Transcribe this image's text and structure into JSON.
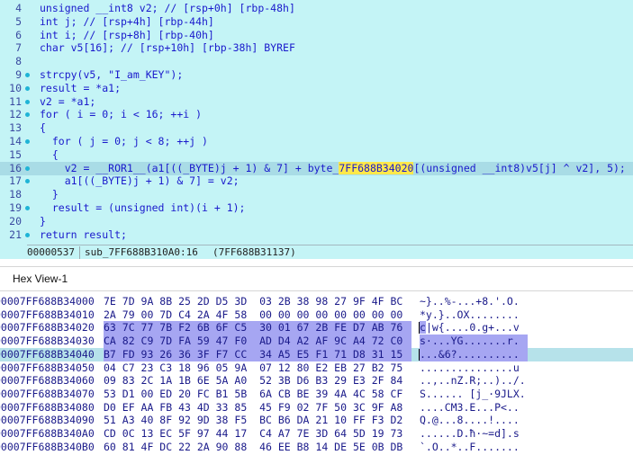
{
  "pseudocode": {
    "lines": [
      {
        "num": "4",
        "text": "unsigned __int8 v2; // [rsp+0h] [rbp-48h]"
      },
      {
        "num": "5",
        "text": "int j; // [rsp+4h] [rbp-44h]"
      },
      {
        "num": "6",
        "text": "int i; // [rsp+8h] [rbp-40h]"
      },
      {
        "num": "7",
        "text": "char v5[16]; // [rsp+10h] [rbp-38h] BYREF"
      },
      {
        "num": "8",
        "text": ""
      },
      {
        "num": "9",
        "text": "strcpy(v5, \"I_am_KEY\");"
      },
      {
        "num": "10",
        "text": "result = *a1;"
      },
      {
        "num": "11",
        "text": "v2 = *a1;"
      },
      {
        "num": "12",
        "text": "for ( i = 0; i < 16; ++i )"
      },
      {
        "num": "13",
        "text": "{"
      },
      {
        "num": "14",
        "text": "  for ( j = 0; j < 8; ++j )"
      },
      {
        "num": "15",
        "text": "  {"
      },
      {
        "num": "16",
        "text": "    v2 = __ROR1__(a1[((_BYTE)j + 1) & 7] + byte_7FF688B34020[(unsigned __int8)v5[j] ^ v2], 5);"
      },
      {
        "num": "17",
        "text": "    a1[((_BYTE)j + 1) & 7] = v2;"
      },
      {
        "num": "18",
        "text": "  }"
      },
      {
        "num": "19",
        "text": "  result = (unsigned int)(i + 1);"
      },
      {
        "num": "20",
        "text": "}"
      },
      {
        "num": "21",
        "text": "return result;"
      }
    ],
    "highlighted_symbol": "7FF688B34020",
    "status": {
      "offset": "00000537",
      "location": "sub_7FF688B310A0:16",
      "address": "(7FF688B31137)"
    }
  },
  "hex_view": {
    "tab_label": "Hex View-1",
    "rows": [
      {
        "addr": "00007FF688B34000",
        "bytes": "7E 7D 9A 8B 25 2D D5 3D  03 2B 38 98 27 9F 4F BC",
        "ascii": "~}..%-...+8.'.O."
      },
      {
        "addr": "00007FF688B34010",
        "bytes": "2A 79 00 7D C4 2A 4F 58  00 00 00 00 00 00 00 00",
        "ascii": "*y.}..OX........"
      },
      {
        "addr": "00007FF688B34020",
        "bytes": "63 7C 77 7B F2 6B 6F C5  30 01 67 2B FE D7 AB 76",
        "ascii": "c|w{....0.g+...v"
      },
      {
        "addr": "00007FF688B34030",
        "bytes": "CA 82 C9 7D FA 59 47 F0  AD D4 A2 AF 9C A4 72 C0",
        "ascii": "s·...YG.......r."
      },
      {
        "addr": "00007FF688B34040",
        "bytes": "B7 FD 93 26 36 3F F7 CC  34 A5 E5 F1 71 D8 31 15",
        "ascii": "...&6?.........."
      },
      {
        "addr": "00007FF688B34050",
        "bytes": "04 C7 23 C3 18 96 05 9A  07 12 80 E2 EB 27 B2 75",
        "ascii": "...............u"
      },
      {
        "addr": "00007FF688B34060",
        "bytes": "09 83 2C 1A 1B 6E 5A A0  52 3B D6 B3 29 E3 2F 84",
        "ascii": "..,..nZ.R;..)../."
      },
      {
        "addr": "00007FF688B34070",
        "bytes": "53 D1 00 ED 20 FC B1 5B  6A CB BE 39 4A 4C 58 CF",
        "ascii": "S...... [j_·9JLX."
      },
      {
        "addr": "00007FF688B34080",
        "bytes": "D0 EF AA FB 43 4D 33 85  45 F9 02 7F 50 3C 9F A8",
        "ascii": "....CM3.E...P<.."
      },
      {
        "addr": "00007FF688B34090",
        "bytes": "51 A3 40 8F 92 9D 38 F5  BC B6 DA 21 10 FF F3 D2",
        "ascii": "Q.@...8....!...."
      },
      {
        "addr": "00007FF688B340A0",
        "bytes": "CD 0C 13 EC 5F 97 44 17  C4 A7 7E 3D 64 5D 19 73",
        "ascii": "......D.ħ·~=d].s"
      },
      {
        "addr": "00007FF688B340B0",
        "bytes": "60 81 4F DC 22 2A 90 88  46 EE B8 14 DE 5E 0B DB",
        "ascii": "`.O..*..F......."
      }
    ]
  }
}
